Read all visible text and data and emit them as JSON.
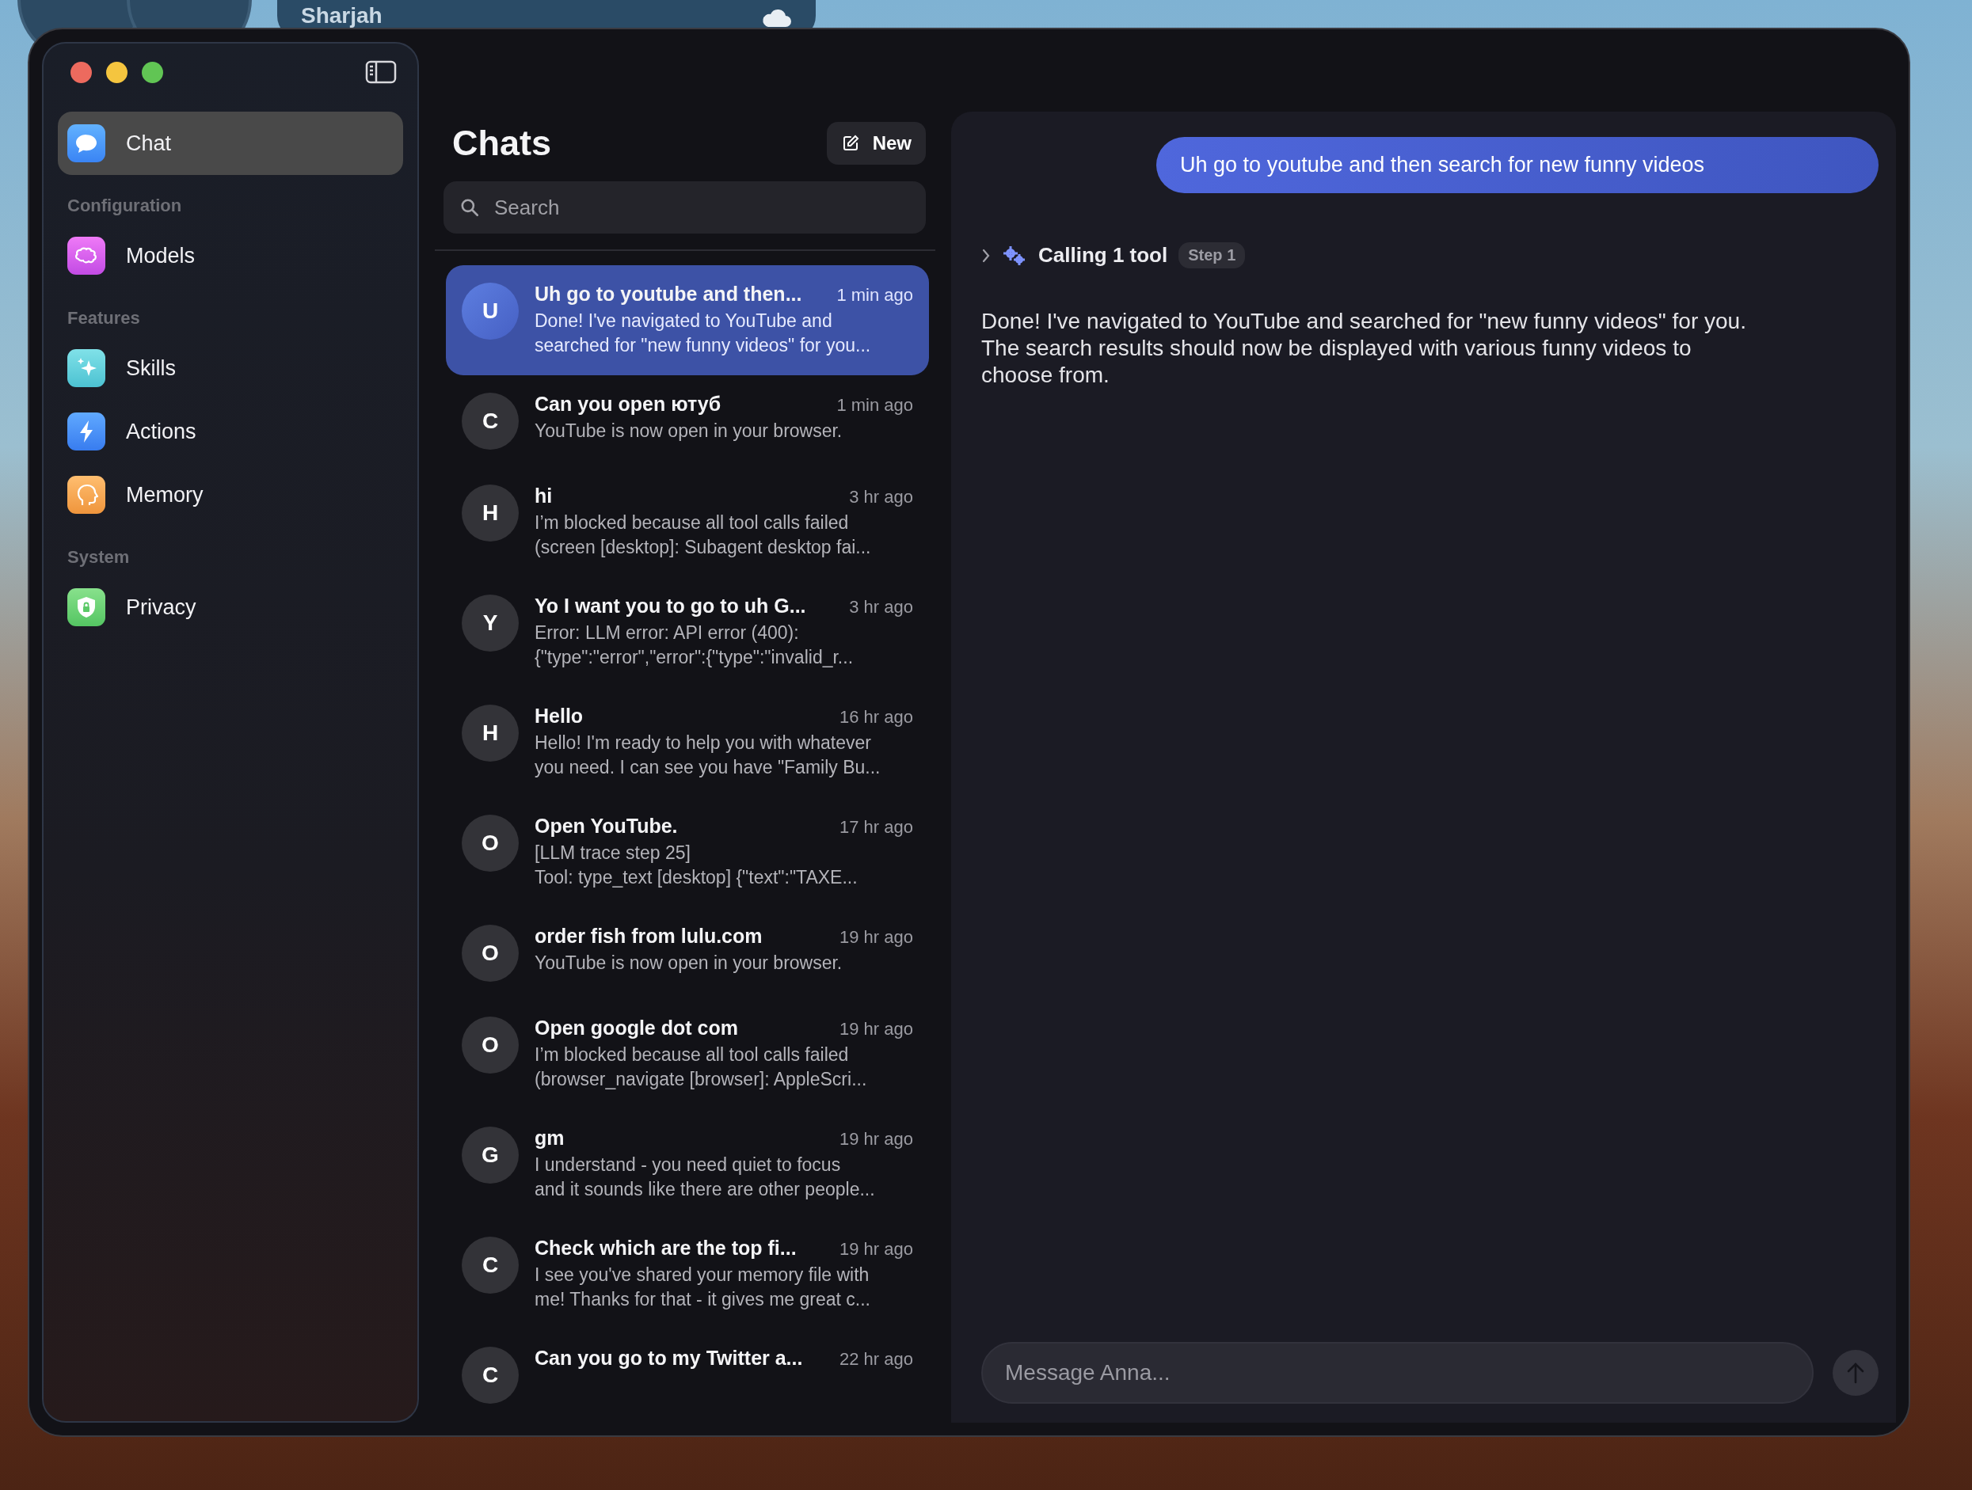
{
  "desktop": {
    "weather_widget": {
      "city": "Sharjah"
    }
  },
  "sidebar": {
    "sections": [
      {
        "items": [
          {
            "label": "Chat",
            "kind": "chat",
            "selected": true
          }
        ]
      },
      {
        "header": "Configuration",
        "items": [
          {
            "label": "Models",
            "kind": "models",
            "selected": false
          }
        ]
      },
      {
        "header": "Features",
        "items": [
          {
            "label": "Skills",
            "kind": "skills",
            "selected": false
          },
          {
            "label": "Actions",
            "kind": "actions",
            "selected": false
          },
          {
            "label": "Memory",
            "kind": "memory",
            "selected": false
          }
        ]
      },
      {
        "header": "System",
        "items": [
          {
            "label": "Privacy",
            "kind": "privacy",
            "selected": false
          }
        ]
      }
    ]
  },
  "chat_list": {
    "title": "Chats",
    "new_button": "New",
    "search": {
      "placeholder": "Search"
    },
    "chats": [
      {
        "initial": "U",
        "title": "Uh go to youtube and then...",
        "time": "1 min ago",
        "preview_lines": [
          "Done! I've navigated to YouTube and",
          "searched for \"new funny videos\" for you..."
        ],
        "selected": true
      },
      {
        "initial": "C",
        "title": "Can you open ютуб",
        "time": "1 min ago",
        "preview_lines": [
          "YouTube is now open in your browser."
        ],
        "selected": false
      },
      {
        "initial": "H",
        "title": "hi",
        "time": "3 hr ago",
        "preview_lines": [
          "I’m blocked because all tool calls failed",
          "(screen [desktop]: Subagent desktop fai..."
        ],
        "selected": false
      },
      {
        "initial": "Y",
        "title": "Yo I want you to go to uh G...",
        "time": "3 hr ago",
        "preview_lines": [
          "Error: LLM error: API error (400):",
          "{\"type\":\"error\",\"error\":{\"type\":\"invalid_r..."
        ],
        "selected": false
      },
      {
        "initial": "H",
        "title": "Hello",
        "time": "16 hr ago",
        "preview_lines": [
          "Hello! I'm ready to help you with whatever",
          "you need. I can see you have \"Family Bu..."
        ],
        "selected": false
      },
      {
        "initial": "O",
        "title": "Open YouTube.",
        "time": "17 hr ago",
        "preview_lines": [
          "[LLM trace step 25]",
          "Tool: type_text [desktop] {\"text\":\"TAXE..."
        ],
        "selected": false
      },
      {
        "initial": "O",
        "title": "order fish from lulu.com",
        "time": "19 hr ago",
        "preview_lines": [
          "YouTube is now open in your browser."
        ],
        "selected": false
      },
      {
        "initial": "O",
        "title": "Open google dot com",
        "time": "19 hr ago",
        "preview_lines": [
          "I’m blocked because all tool calls failed",
          "(browser_navigate [browser]: AppleScri..."
        ],
        "selected": false
      },
      {
        "initial": "G",
        "title": "gm",
        "time": "19 hr ago",
        "preview_lines": [
          "I understand - you need quiet to focus",
          "and it sounds like there are other people..."
        ],
        "selected": false
      },
      {
        "initial": "C",
        "title": "Check which are the top fi...",
        "time": "19 hr ago",
        "preview_lines": [
          "I see you've shared your memory file with",
          "me! Thanks for that - it gives me great c..."
        ],
        "selected": false
      },
      {
        "initial": "C",
        "title": "Can you go to my Twitter a...",
        "time": "22 hr ago",
        "selected": false
      }
    ]
  },
  "conversation": {
    "user_message": "Uh go to youtube and then search for new funny videos",
    "tool_call": {
      "label": "Calling 1 tool",
      "step": "Step 1",
      "expanded": false
    },
    "response_lines": [
      "Done! I've navigated to YouTube and searched for \"new funny videos\" for you.",
      "The search results should now be displayed with various funny videos to",
      "choose from."
    ],
    "composer": {
      "placeholder": "Message Anna..."
    }
  }
}
